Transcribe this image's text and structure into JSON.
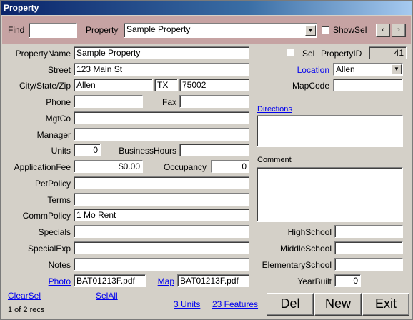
{
  "window": {
    "title": "Property"
  },
  "findbar": {
    "find_label": "Find",
    "find_value": "",
    "property_label": "Property",
    "property_value": "Sample Property",
    "showsel_label": "ShowSel",
    "prev_icon": "chevron-left-icon",
    "next_icon": "chevron-right-icon"
  },
  "form": {
    "property_name_label": "PropertyName",
    "property_name_value": "Sample Property",
    "street_label": "Street",
    "street_value": "123 Main St",
    "city_label": "City/State/Zip",
    "city_value": "Allen",
    "state_value": "TX",
    "zip_value": "75002",
    "phone_label": "Phone",
    "phone_value": "",
    "fax_label": "Fax",
    "fax_value": "",
    "mgtco_label": "MgtCo",
    "mgtco_value": "",
    "manager_label": "Manager",
    "manager_value": "",
    "units_label": "Units",
    "units_value": "0",
    "business_hours_label": "BusinessHours",
    "business_hours_value": "",
    "application_fee_label": "ApplicationFee",
    "application_fee_value": "$0.00",
    "occupancy_label": "Occupancy",
    "occupancy_value": "0",
    "pet_policy_label": "PetPolicy",
    "pet_policy_value": "",
    "terms_label": "Terms",
    "terms_value": "",
    "comm_policy_label": "CommPolicy",
    "comm_policy_value": "1 Mo Rent",
    "specials_label": "Specials",
    "specials_value": "",
    "special_exp_label": "SpecialExp",
    "special_exp_value": "",
    "notes_label": "Notes",
    "notes_value": "",
    "photo_label": "Photo",
    "photo_value": "BAT01213F.pdf",
    "map_label": "Map",
    "map_value": "BAT01213F.pdf"
  },
  "right": {
    "sel_label": "Sel",
    "property_id_label": "PropertyID",
    "property_id_value": "41",
    "location_label": "Location",
    "location_value": "Allen",
    "mapcode_label": "MapCode",
    "mapcode_value": "",
    "directions_label": "Directions",
    "directions_value": "",
    "comment_label": "Comment",
    "comment_value": "",
    "high_school_label": "HighSchool",
    "high_school_value": "",
    "middle_school_label": "MiddleSchool",
    "middle_school_value": "",
    "elementary_school_label": "ElementarySchool",
    "elementary_school_value": "",
    "year_built_label": "YearBuilt",
    "year_built_value": "0"
  },
  "footer": {
    "clear_sel": "ClearSel",
    "sel_all": "SelAll",
    "record_count": "1 of 2 recs",
    "units_link": "3 Units",
    "features_link": "23 Features",
    "del_label": "Del",
    "new_label": "New",
    "exit_label": "Exit"
  }
}
